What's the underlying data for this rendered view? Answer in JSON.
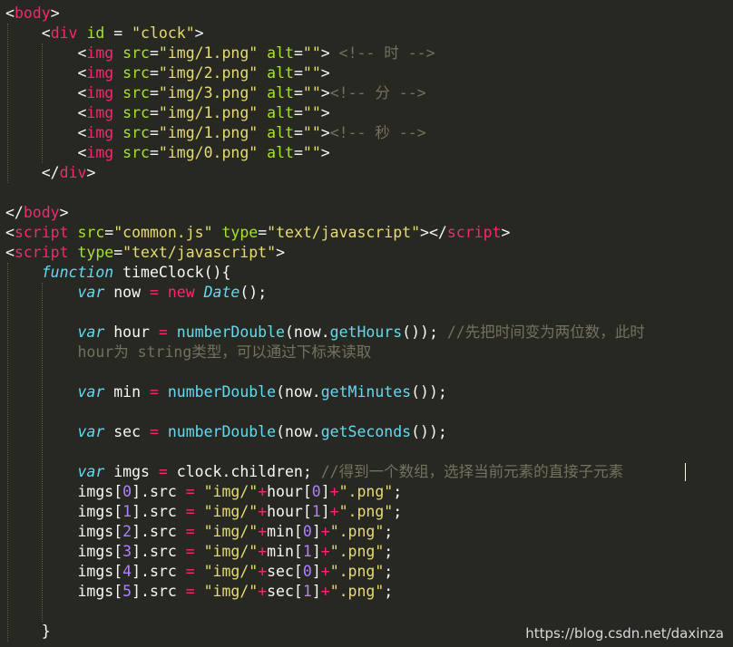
{
  "colors": {
    "background": "#272822",
    "tag": "#F92672",
    "attr": "#A6E22E",
    "string": "#E6DB74",
    "comment": "#75715E",
    "keyword": "#66D9EF",
    "number": "#AE81FF",
    "text": "#F8F8F2"
  },
  "code_lines": [
    [
      [
        "<",
        "text"
      ],
      [
        "body",
        "tag"
      ],
      [
        ">",
        "text"
      ]
    ],
    [
      [
        "    ",
        "text"
      ],
      [
        "<",
        "text"
      ],
      [
        "div",
        "tag"
      ],
      [
        " ",
        "text"
      ],
      [
        "id",
        "attr"
      ],
      [
        " = ",
        "text"
      ],
      [
        "\"clock\"",
        "string"
      ],
      [
        ">",
        "text"
      ]
    ],
    [
      [
        "        ",
        "text"
      ],
      [
        "<",
        "text"
      ],
      [
        "img",
        "tag"
      ],
      [
        " ",
        "text"
      ],
      [
        "src",
        "attr"
      ],
      [
        "=",
        "text"
      ],
      [
        "\"img/1.png\"",
        "string"
      ],
      [
        " ",
        "text"
      ],
      [
        "alt",
        "attr"
      ],
      [
        "=",
        "text"
      ],
      [
        "\"\"",
        "string"
      ],
      [
        "> ",
        "text"
      ],
      [
        "<!-- 时 -->",
        "comment"
      ]
    ],
    [
      [
        "        ",
        "text"
      ],
      [
        "<",
        "text"
      ],
      [
        "img",
        "tag"
      ],
      [
        " ",
        "text"
      ],
      [
        "src",
        "attr"
      ],
      [
        "=",
        "text"
      ],
      [
        "\"img/2.png\"",
        "string"
      ],
      [
        " ",
        "text"
      ],
      [
        "alt",
        "attr"
      ],
      [
        "=",
        "text"
      ],
      [
        "\"\"",
        "string"
      ],
      [
        ">",
        "text"
      ]
    ],
    [
      [
        "        ",
        "text"
      ],
      [
        "<",
        "text"
      ],
      [
        "img",
        "tag"
      ],
      [
        " ",
        "text"
      ],
      [
        "src",
        "attr"
      ],
      [
        "=",
        "text"
      ],
      [
        "\"img/3.png\"",
        "string"
      ],
      [
        " ",
        "text"
      ],
      [
        "alt",
        "attr"
      ],
      [
        "=",
        "text"
      ],
      [
        "\"\"",
        "string"
      ],
      [
        ">",
        "text"
      ],
      [
        "<!-- 分 -->",
        "comment"
      ]
    ],
    [
      [
        "        ",
        "text"
      ],
      [
        "<",
        "text"
      ],
      [
        "img",
        "tag"
      ],
      [
        " ",
        "text"
      ],
      [
        "src",
        "attr"
      ],
      [
        "=",
        "text"
      ],
      [
        "\"img/1.png\"",
        "string"
      ],
      [
        " ",
        "text"
      ],
      [
        "alt",
        "attr"
      ],
      [
        "=",
        "text"
      ],
      [
        "\"\"",
        "string"
      ],
      [
        ">",
        "text"
      ]
    ],
    [
      [
        "        ",
        "text"
      ],
      [
        "<",
        "text"
      ],
      [
        "img",
        "tag"
      ],
      [
        " ",
        "text"
      ],
      [
        "src",
        "attr"
      ],
      [
        "=",
        "text"
      ],
      [
        "\"img/1.png\"",
        "string"
      ],
      [
        " ",
        "text"
      ],
      [
        "alt",
        "attr"
      ],
      [
        "=",
        "text"
      ],
      [
        "\"\"",
        "string"
      ],
      [
        ">",
        "text"
      ],
      [
        "<!-- 秒 -->",
        "comment"
      ]
    ],
    [
      [
        "        ",
        "text"
      ],
      [
        "<",
        "text"
      ],
      [
        "img",
        "tag"
      ],
      [
        " ",
        "text"
      ],
      [
        "src",
        "attr"
      ],
      [
        "=",
        "text"
      ],
      [
        "\"img/0.png\"",
        "string"
      ],
      [
        " ",
        "text"
      ],
      [
        "alt",
        "attr"
      ],
      [
        "=",
        "text"
      ],
      [
        "\"\"",
        "string"
      ],
      [
        ">",
        "text"
      ]
    ],
    [
      [
        "    ",
        "text"
      ],
      [
        "</",
        "text"
      ],
      [
        "div",
        "tag"
      ],
      [
        ">",
        "text"
      ]
    ],
    [],
    [
      [
        "</",
        "text"
      ],
      [
        "body",
        "tag"
      ],
      [
        ">",
        "text"
      ]
    ],
    [
      [
        "<",
        "text"
      ],
      [
        "script",
        "tag"
      ],
      [
        " ",
        "text"
      ],
      [
        "src",
        "attr"
      ],
      [
        "=",
        "text"
      ],
      [
        "\"common.js\"",
        "string"
      ],
      [
        " ",
        "text"
      ],
      [
        "type",
        "attr"
      ],
      [
        "=",
        "text"
      ],
      [
        "\"text/javascript\"",
        "string"
      ],
      [
        "></",
        "text"
      ],
      [
        "script",
        "tag"
      ],
      [
        ">",
        "text"
      ]
    ],
    [
      [
        "<",
        "text"
      ],
      [
        "script",
        "tag"
      ],
      [
        " ",
        "text"
      ],
      [
        "type",
        "attr"
      ],
      [
        "=",
        "text"
      ],
      [
        "\"text/javascript\"",
        "string"
      ],
      [
        ">",
        "text"
      ]
    ],
    [
      [
        "    ",
        "text"
      ],
      [
        "function",
        "keyword_i"
      ],
      [
        " ",
        "text"
      ],
      [
        "timeClock",
        "text"
      ],
      [
        "(){",
        "text"
      ]
    ],
    [
      [
        "        ",
        "text"
      ],
      [
        "var",
        "keyword_i"
      ],
      [
        " now ",
        "text"
      ],
      [
        "=",
        "tag"
      ],
      [
        " ",
        "text"
      ],
      [
        "new",
        "tag"
      ],
      [
        " ",
        "text"
      ],
      [
        "Date",
        "keyword_i"
      ],
      [
        "();",
        "text"
      ]
    ],
    [],
    [
      [
        "        ",
        "text"
      ],
      [
        "var",
        "keyword_i"
      ],
      [
        " hour ",
        "text"
      ],
      [
        "=",
        "tag"
      ],
      [
        " ",
        "text"
      ],
      [
        "numberDouble",
        "keyword"
      ],
      [
        "(now.",
        "text"
      ],
      [
        "getHours",
        "keyword"
      ],
      [
        "()); ",
        "text"
      ],
      [
        "//先把时间变为两位数，此时",
        "comment"
      ]
    ],
    [
      [
        "        ",
        "text"
      ],
      [
        "hour为 string类型，可以通过下标来读取",
        "comment"
      ]
    ],
    [],
    [
      [
        "        ",
        "text"
      ],
      [
        "var",
        "keyword_i"
      ],
      [
        " min ",
        "text"
      ],
      [
        "=",
        "tag"
      ],
      [
        " ",
        "text"
      ],
      [
        "numberDouble",
        "keyword"
      ],
      [
        "(now.",
        "text"
      ],
      [
        "getMinutes",
        "keyword"
      ],
      [
        "());",
        "text"
      ]
    ],
    [],
    [
      [
        "        ",
        "text"
      ],
      [
        "var",
        "keyword_i"
      ],
      [
        " sec ",
        "text"
      ],
      [
        "=",
        "tag"
      ],
      [
        " ",
        "text"
      ],
      [
        "numberDouble",
        "keyword"
      ],
      [
        "(now.",
        "text"
      ],
      [
        "getSeconds",
        "keyword"
      ],
      [
        "());",
        "text"
      ]
    ],
    [],
    [
      [
        "        ",
        "text"
      ],
      [
        "var",
        "keyword_i"
      ],
      [
        " imgs ",
        "text"
      ],
      [
        "=",
        "tag"
      ],
      [
        " clock.children; ",
        "text"
      ],
      [
        "//得到一个数组，选择当前元素的直接子元素",
        "comment"
      ]
    ],
    [
      [
        "        ",
        "text"
      ],
      [
        "imgs[",
        "text"
      ],
      [
        "0",
        "number"
      ],
      [
        "].src ",
        "text"
      ],
      [
        "=",
        "tag"
      ],
      [
        " ",
        "text"
      ],
      [
        "\"img/\"",
        "string"
      ],
      [
        "+",
        "tag"
      ],
      [
        "hour[",
        "text"
      ],
      [
        "0",
        "number"
      ],
      [
        "]",
        "text"
      ],
      [
        "+",
        "tag"
      ],
      [
        "\".png\"",
        "string"
      ],
      [
        ";",
        "text"
      ]
    ],
    [
      [
        "        ",
        "text"
      ],
      [
        "imgs[",
        "text"
      ],
      [
        "1",
        "number"
      ],
      [
        "].src ",
        "text"
      ],
      [
        "=",
        "tag"
      ],
      [
        " ",
        "text"
      ],
      [
        "\"img/\"",
        "string"
      ],
      [
        "+",
        "tag"
      ],
      [
        "hour[",
        "text"
      ],
      [
        "1",
        "number"
      ],
      [
        "]",
        "text"
      ],
      [
        "+",
        "tag"
      ],
      [
        "\".png\"",
        "string"
      ],
      [
        ";",
        "text"
      ]
    ],
    [
      [
        "        ",
        "text"
      ],
      [
        "imgs[",
        "text"
      ],
      [
        "2",
        "number"
      ],
      [
        "].src ",
        "text"
      ],
      [
        "=",
        "tag"
      ],
      [
        " ",
        "text"
      ],
      [
        "\"img/\"",
        "string"
      ],
      [
        "+",
        "tag"
      ],
      [
        "min[",
        "text"
      ],
      [
        "0",
        "number"
      ],
      [
        "]",
        "text"
      ],
      [
        "+",
        "tag"
      ],
      [
        "\".png\"",
        "string"
      ],
      [
        ";",
        "text"
      ]
    ],
    [
      [
        "        ",
        "text"
      ],
      [
        "imgs[",
        "text"
      ],
      [
        "3",
        "number"
      ],
      [
        "].src ",
        "text"
      ],
      [
        "=",
        "tag"
      ],
      [
        " ",
        "text"
      ],
      [
        "\"img/\"",
        "string"
      ],
      [
        "+",
        "tag"
      ],
      [
        "min[",
        "text"
      ],
      [
        "1",
        "number"
      ],
      [
        "]",
        "text"
      ],
      [
        "+",
        "tag"
      ],
      [
        "\".png\"",
        "string"
      ],
      [
        ";",
        "text"
      ]
    ],
    [
      [
        "        ",
        "text"
      ],
      [
        "imgs[",
        "text"
      ],
      [
        "4",
        "number"
      ],
      [
        "].src ",
        "text"
      ],
      [
        "=",
        "tag"
      ],
      [
        " ",
        "text"
      ],
      [
        "\"img/\"",
        "string"
      ],
      [
        "+",
        "tag"
      ],
      [
        "sec[",
        "text"
      ],
      [
        "0",
        "number"
      ],
      [
        "]",
        "text"
      ],
      [
        "+",
        "tag"
      ],
      [
        "\".png\"",
        "string"
      ],
      [
        ";",
        "text"
      ]
    ],
    [
      [
        "        ",
        "text"
      ],
      [
        "imgs[",
        "text"
      ],
      [
        "5",
        "number"
      ],
      [
        "].src ",
        "text"
      ],
      [
        "=",
        "tag"
      ],
      [
        " ",
        "text"
      ],
      [
        "\"img/\"",
        "string"
      ],
      [
        "+",
        "tag"
      ],
      [
        "sec[",
        "text"
      ],
      [
        "1",
        "number"
      ],
      [
        "]",
        "text"
      ],
      [
        "+",
        "tag"
      ],
      [
        "\".png\"",
        "string"
      ],
      [
        ";",
        "text"
      ]
    ],
    [],
    [
      [
        "    ",
        "text"
      ],
      [
        "}",
        "text"
      ]
    ]
  ],
  "watermark": "https://blog.csdn.net/daxinza"
}
